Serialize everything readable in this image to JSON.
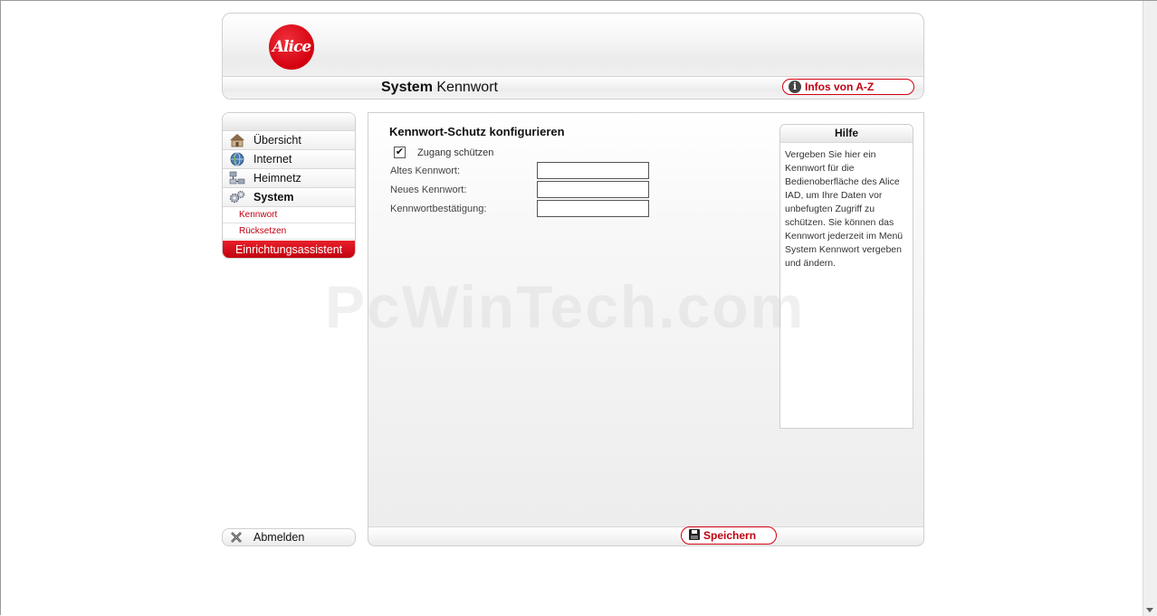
{
  "header": {
    "logo_text": "Alice",
    "title_bold": "System",
    "title_rest": "Kennwort",
    "infos_button": "Infos von A-Z"
  },
  "nav": {
    "items": [
      {
        "label": "Übersicht",
        "icon": "house-icon"
      },
      {
        "label": "Internet",
        "icon": "globe-icon"
      },
      {
        "label": "Heimnetz",
        "icon": "network-icon"
      },
      {
        "label": "System",
        "icon": "gears-icon",
        "active": true
      }
    ],
    "subitems": [
      {
        "label": "Kennwort"
      },
      {
        "label": "Rücksetzen"
      }
    ],
    "assistant": "Einrichtungsassistent",
    "logout": "Abmelden"
  },
  "content": {
    "section_title": "Kennwort-Schutz konfigurieren",
    "checkbox_label": "Zugang schützen",
    "checkbox_checked": true,
    "fields": [
      {
        "label": "Altes Kennwort:",
        "value": ""
      },
      {
        "label": "Neues Kennwort:",
        "value": ""
      },
      {
        "label": "Kennwortbestätigung:",
        "value": ""
      }
    ],
    "save_button": "Speichern"
  },
  "help": {
    "title": "Hilfe",
    "text": "Vergeben Sie hier ein Kennwort für die Bedienoberfläche des Alice IAD, um Ihre Daten vor unbefugten Zugriff zu schützen. Sie können das Kennwort jederzeit im Menü System Kennwort vergeben und ändern."
  },
  "watermark": "PcWinTech.com",
  "colors": {
    "accent": "#c00010",
    "assistant_bg": "#d40010"
  }
}
